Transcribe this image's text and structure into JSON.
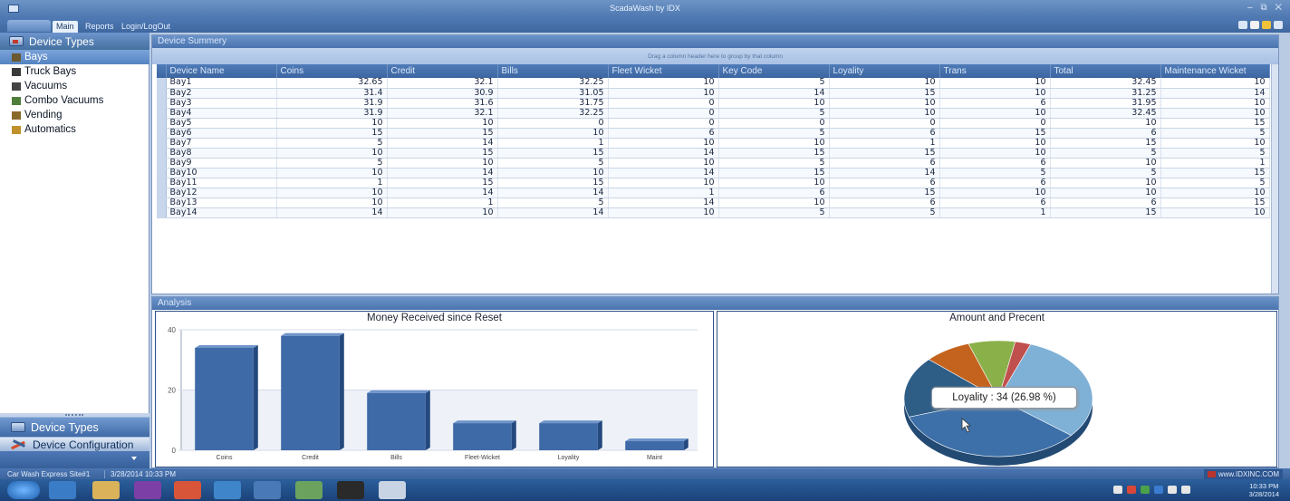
{
  "window": {
    "title": "ScadaWash by IDX"
  },
  "ribbon": {
    "tabs": [
      "Main",
      "Reports",
      "Login/LogOut"
    ]
  },
  "sidebar": {
    "header": "Device Types",
    "items": [
      {
        "label": "Bays",
        "icon": "bay-icon",
        "color": "#6b5a2f",
        "selected": true
      },
      {
        "label": "Truck Bays",
        "icon": "truck-bay-icon",
        "color": "#3a3a3a",
        "selected": false
      },
      {
        "label": "Vacuums",
        "icon": "vacuum-icon",
        "color": "#444444",
        "selected": false
      },
      {
        "label": "Combo Vacuums",
        "icon": "combo-vacuum-icon",
        "color": "#4f7d3a",
        "selected": false
      },
      {
        "label": "Vending",
        "icon": "vending-icon",
        "color": "#8a6a2a",
        "selected": false
      },
      {
        "label": "Automatics",
        "icon": "automatics-icon",
        "color": "#c0902a",
        "selected": false
      }
    ],
    "bottom_buttons": [
      "Device Types",
      "Device Configuration"
    ]
  },
  "summary": {
    "title": "Device Summery",
    "group_hint": "Drag a column header here to group by that column",
    "columns": [
      "Device Name",
      "Coins",
      "Credit",
      "Bills",
      "Fleet Wicket",
      "Key Code",
      "Loyality",
      "Trans",
      "Total",
      "Maintenance Wicket"
    ],
    "rows": [
      [
        "Bay1",
        "32.65",
        "32.1",
        "32.25",
        "10",
        "5",
        "10",
        "10",
        "32.45",
        "10"
      ],
      [
        "Bay2",
        "31.4",
        "30.9",
        "31.05",
        "10",
        "14",
        "15",
        "10",
        "31.25",
        "14"
      ],
      [
        "Bay3",
        "31.9",
        "31.6",
        "31.75",
        "0",
        "10",
        "10",
        "6",
        "31.95",
        "10"
      ],
      [
        "Bay4",
        "31.9",
        "32.1",
        "32.25",
        "0",
        "5",
        "10",
        "10",
        "32.45",
        "10"
      ],
      [
        "Bay5",
        "10",
        "10",
        "0",
        "0",
        "0",
        "0",
        "0",
        "10",
        "15"
      ],
      [
        "Bay6",
        "15",
        "15",
        "10",
        "6",
        "5",
        "6",
        "15",
        "6",
        "5"
      ],
      [
        "Bay7",
        "5",
        "14",
        "1",
        "10",
        "10",
        "1",
        "10",
        "15",
        "10"
      ],
      [
        "Bay8",
        "10",
        "15",
        "15",
        "14",
        "15",
        "15",
        "10",
        "5",
        "5"
      ],
      [
        "Bay9",
        "5",
        "10",
        "5",
        "10",
        "5",
        "6",
        "6",
        "10",
        "1"
      ],
      [
        "Bay10",
        "10",
        "14",
        "10",
        "14",
        "15",
        "14",
        "5",
        "5",
        "15"
      ],
      [
        "Bay11",
        "1",
        "15",
        "15",
        "10",
        "10",
        "6",
        "6",
        "10",
        "5"
      ],
      [
        "Bay12",
        "10",
        "14",
        "14",
        "1",
        "6",
        "15",
        "10",
        "10",
        "10"
      ],
      [
        "Bay13",
        "10",
        "1",
        "5",
        "14",
        "10",
        "6",
        "6",
        "6",
        "15"
      ],
      [
        "Bay14",
        "14",
        "10",
        "14",
        "10",
        "5",
        "5",
        "1",
        "15",
        "10"
      ]
    ]
  },
  "analysis": {
    "title": "Analysis"
  },
  "chart_data": [
    {
      "type": "bar",
      "title": "Money Received since Reset",
      "categories": [
        "Coins",
        "Credit",
        "Bills",
        "Fleet-Wicket",
        "Loyality",
        "Maint"
      ],
      "values": [
        34,
        38,
        19,
        9,
        9,
        3
      ],
      "ylim": [
        0,
        40
      ],
      "yticks": [
        "0",
        "20",
        "40"
      ],
      "grid": true,
      "bar_color": "#3f6aa8"
    },
    {
      "type": "pie",
      "title": "Amount and Precent",
      "slices": [
        {
          "name": "Coins",
          "value": 34,
          "color": "#7fb0d6"
        },
        {
          "name": "Credit",
          "value": 38,
          "color": "#3d6fa8"
        },
        {
          "name": "Bills",
          "value": 19,
          "color": "#2e5d86"
        },
        {
          "name": "Fleet-Wicket",
          "value": 9,
          "color": "#c4631e"
        },
        {
          "name": "Loyality",
          "value": 9,
          "color": "#8ab04a"
        },
        {
          "name": "Maint",
          "value": 3,
          "color": "#c0504d"
        }
      ],
      "tooltip": "Loyality : 34 (26.98 %)"
    }
  ],
  "statusbar": {
    "site": "Car Wash Express Site#1",
    "datetime": "3/28/2014 10:33 PM",
    "brand": "www.IDXINC.COM"
  },
  "taskbar": {
    "time": "10:33 PM",
    "date": "3/28/2014"
  }
}
